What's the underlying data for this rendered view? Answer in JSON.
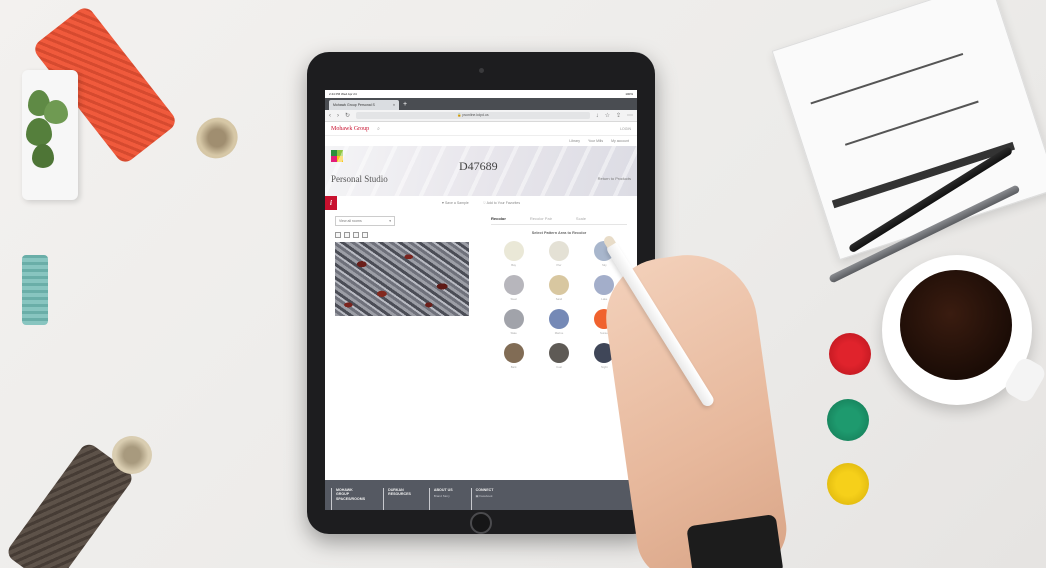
{
  "device": {
    "status_time": "2:44 PM  Wed Apr 24",
    "status_battery": "100%"
  },
  "browser": {
    "tab_title": "Mohawk Group Personal S",
    "tab_close": "×",
    "new_tab": "+",
    "url": "psonline.kdpd.us"
  },
  "site": {
    "logo": "Mohawk Group",
    "login": "LOGIN",
    "util_links": [
      "Library",
      "Your Mills",
      "My account"
    ]
  },
  "hero": {
    "brand": "Personal Studio",
    "pattern_code": "D47689",
    "return_link": "Return to Products",
    "logo_colors": [
      "#2a8f3c",
      "#8fc640",
      "#e31c79",
      "#f7c61a"
    ]
  },
  "actions": {
    "info_icon": "i",
    "save_label": "Save a Sample",
    "add_label": "Add to Your Favorites"
  },
  "viewer": {
    "view_select": "View all rooms",
    "view_icon_count": 4
  },
  "recolor": {
    "tabs": [
      "Recolor",
      "Recolor Pair",
      "Scale"
    ],
    "instruction": "Select Pattern Area to Recolor",
    "colors": [
      {
        "hex": "#eae8d7",
        "label": "Bay"
      },
      {
        "hex": "#e4e1d5",
        "label": "Pier"
      },
      {
        "hex": "#a8b6cc",
        "label": "Sky"
      },
      {
        "hex": "#b7b6bc",
        "label": "Steel"
      },
      {
        "hex": "#d8c7a0",
        "label": "Sand"
      },
      {
        "hex": "#a3aeca",
        "label": "Lake"
      },
      {
        "hex": "#a1a3aa",
        "label": "Slate"
      },
      {
        "hex": "#7589b6",
        "label": "Marine"
      },
      {
        "hex": "#f0622e",
        "label": "Sunset"
      },
      {
        "hex": "#816c55",
        "label": "Bark"
      },
      {
        "hex": "#5e5a55",
        "label": "Coal"
      },
      {
        "hex": "#3f4658",
        "label": "Night"
      }
    ]
  },
  "footer": {
    "columns": [
      {
        "head": [
          "MOHAWK",
          "GROUP",
          "SPACES/ROOMS"
        ],
        "sub": ""
      },
      {
        "head": [
          "DURKAN",
          "RESOURCES"
        ],
        "sub": ""
      },
      {
        "head": [
          "ABOUT US"
        ],
        "sub": "Brand Story"
      },
      {
        "head": [
          "CONNECT"
        ],
        "sub": "Facebook"
      }
    ]
  }
}
